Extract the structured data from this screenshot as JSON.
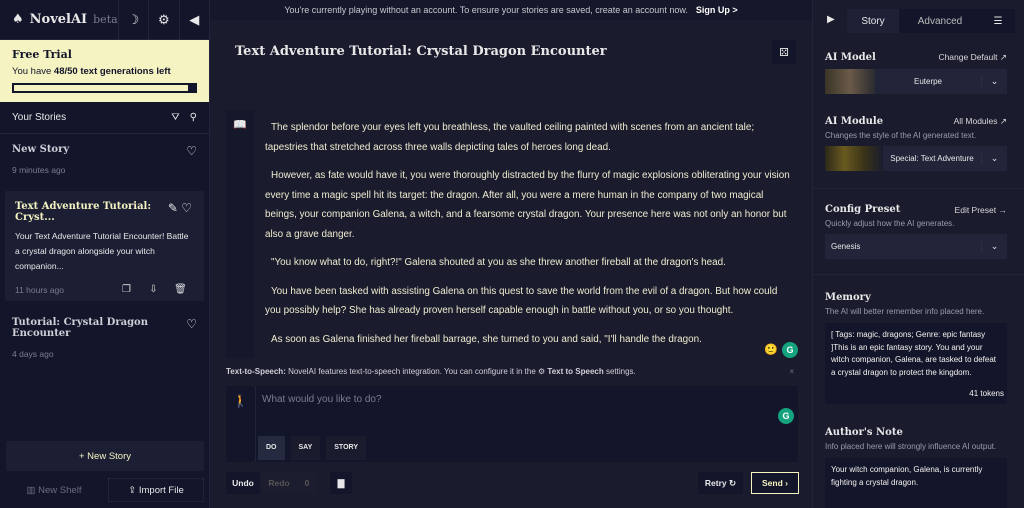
{
  "brand": {
    "name": "NovelAI",
    "tag": "beta"
  },
  "trial": {
    "title": "Free Trial",
    "text_pre": "You have ",
    "count": "48/50",
    "text_post": " text generations left",
    "progress": 0.96
  },
  "stories_header": "Your Stories",
  "stories": [
    {
      "title": "New Story",
      "time": "9 minutes ago"
    },
    {
      "title": "Text Adventure Tutorial: Cryst...",
      "desc": "Your Text Adventure Tutorial Encounter! Battle a crystal dragon alongside your witch companion...",
      "time": "11 hours ago"
    },
    {
      "title": "Tutorial: Crystal Dragon Encounter",
      "time": "4 days ago"
    }
  ],
  "sidebar_buttons": {
    "new_story": "New Story",
    "new_shelf": "New Shelf",
    "import_file": "Import File"
  },
  "banner": {
    "text": "You're currently playing without an account. To ensure your stories are saved, create an account now.",
    "link": "Sign Up >"
  },
  "story_title": "Text Adventure Tutorial: Crystal Dragon Encounter",
  "paragraphs": [
    "The splendor before your eyes left you breathless, the vaulted ceiling painted with scenes from an ancient tale; tapestries that stretched across three walls depicting tales of heroes long dead.",
    "However, as fate would have it, you were thoroughly distracted by the flurry of magic explosions obliterating your vision every time a magic spell hit its target: the dragon. After all, you were a mere human in the company of two magical beings, your companion Galena, a witch, and a fearsome crystal dragon. Your presence here was not only an honor but also a grave danger.",
    "\"You know what to do, right?!\" Galena shouted at you as she threw another fireball at the dragon's head.",
    "You have been tasked with assisting Galena on this quest to save the world from the evil of a dragon. But how could you possibly help? She has already proven herself capable enough in battle without you, or so you thought.",
    "As soon as Galena finished her fireball barrage, she turned to you and said, \"I'll handle the dragon."
  ],
  "tts": {
    "label": "Text-to-Speech:",
    "text": " NovelAI features text-to-speech integration. You can configure it in the ",
    "link": "Text to Speech",
    "end": " settings."
  },
  "input": {
    "placeholder": "What would you like to do?",
    "modes": [
      "DO",
      "SAY",
      "STORY"
    ]
  },
  "actions": {
    "undo": "Undo",
    "redo": "Redo",
    "count": "0",
    "retry": "Retry",
    "send": "Send"
  },
  "right": {
    "tabs": [
      "Story",
      "Advanced"
    ],
    "model": {
      "title": "AI Model",
      "link": "Change Default",
      "value": "Euterpe"
    },
    "module": {
      "title": "AI Module",
      "link": "All Modules",
      "sub": "Changes the style of the AI generated text.",
      "value": "Special: Text Adventure"
    },
    "preset": {
      "title": "Config Preset",
      "link": "Edit Preset",
      "sub": "Quickly adjust how the AI generates.",
      "value": "Genesis"
    },
    "memory": {
      "title": "Memory",
      "sub": "The AI will better remember info placed here.",
      "text": "[ Tags: magic, dragons; Genre: epic fantasy ]This is an epic fantasy story. You and your witch companion, Galena, are tasked to defeat a crystal dragon to protect the kingdom.",
      "tokens": "41 tokens"
    },
    "note": {
      "title": "Author's Note",
      "sub": "Info placed here will strongly influence AI output.",
      "text": "Your witch companion, Galena, is currently fighting a crystal dragon."
    }
  },
  "colors": {
    "accent": "#f5f3c2",
    "bg": "#1a1c2e",
    "panel": "#13152a"
  }
}
